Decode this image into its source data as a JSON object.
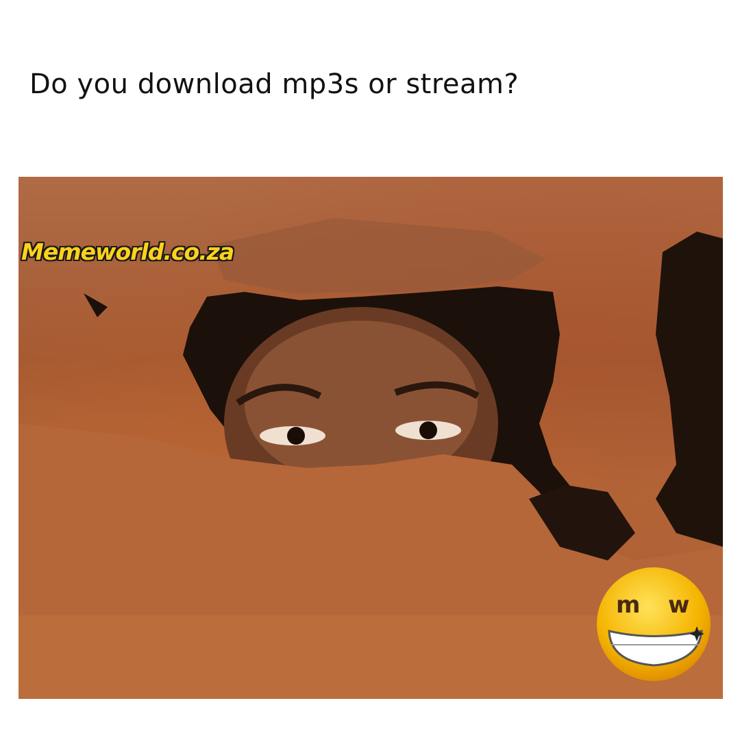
{
  "caption": "Do you download mp3s or stream?",
  "watermark": "Memeworld.co.za",
  "logo": {
    "icon": "memeworld-grin-logo",
    "letters": "m w",
    "color": "#f5b400"
  }
}
